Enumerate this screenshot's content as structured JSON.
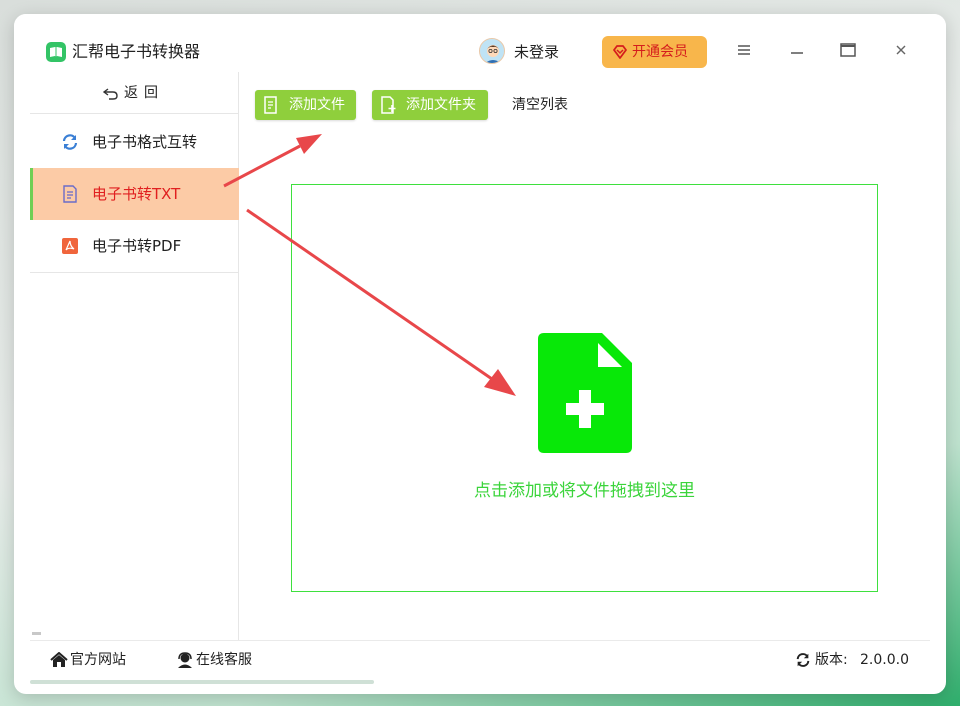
{
  "app": {
    "title": "汇帮电子书转换器"
  },
  "header": {
    "user_label": "未登录",
    "vip_label": "开通会员"
  },
  "sidebar": {
    "back_label": "返回",
    "items": [
      {
        "label": "电子书格式互转",
        "icon": "sync-icon"
      },
      {
        "label": "电子书转TXT",
        "icon": "txt-document-icon",
        "active": true
      },
      {
        "label": "电子书转PDF",
        "icon": "pdf-icon"
      }
    ]
  },
  "toolbar": {
    "add_file_label": "添加文件",
    "add_folder_label": "添加文件夹",
    "clear_label": "清空列表"
  },
  "dropzone": {
    "hint": "点击添加或将文件拖拽到这里"
  },
  "footer": {
    "website_label": "官方网站",
    "support_label": "在线客服",
    "version_label": "版本:",
    "version_value": "2.0.0.0"
  },
  "colors": {
    "accent_green": "#8fcf3c",
    "active_bg": "#fccba6",
    "active_text": "#e02020",
    "vip_bg": "#f8b64b",
    "drop_green": "#3bd43b",
    "arrow_red": "#e8474a"
  }
}
